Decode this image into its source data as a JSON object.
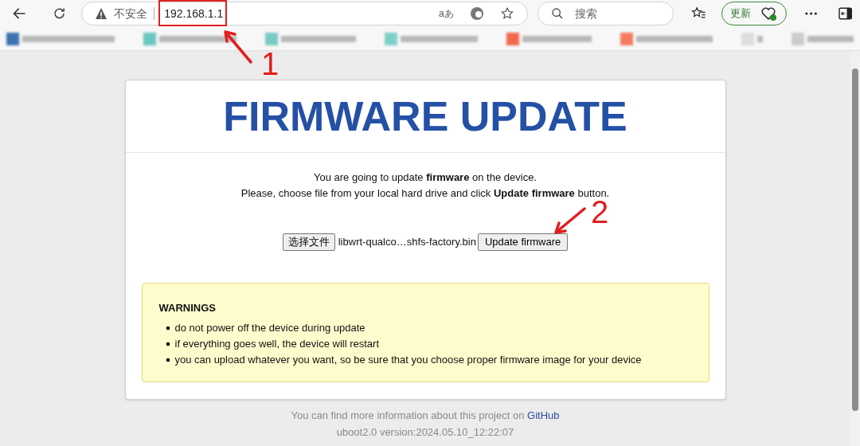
{
  "browser": {
    "security_label": "不安全",
    "url": "192.168.1.1",
    "search_placeholder": "搜索",
    "update_button": "更新",
    "read_aloud": "aあ"
  },
  "page": {
    "title": "FIRMWARE UPDATE",
    "intro": [
      "You are going to update **firmware** on the device.",
      "Please, choose file from your local hard drive and click **Update firmware** button."
    ],
    "file_button": "选择文件",
    "file_name": "libwrt-qualco…shfs-factory.bin",
    "submit_button": "Update firmware",
    "warnings": {
      "heading": "WARNINGS",
      "items": [
        "do not power off the device during update",
        "if everything goes well, the device will restart",
        "you can upload whatever you want, so be sure that you choose proper firmware image for your device"
      ]
    }
  },
  "footer": {
    "info": "You can find more information about this project on",
    "link": "GitHub",
    "version": "uboot2.0 version:2024.05.10_12:22:07"
  },
  "annotations": [
    "1",
    "2"
  ]
}
